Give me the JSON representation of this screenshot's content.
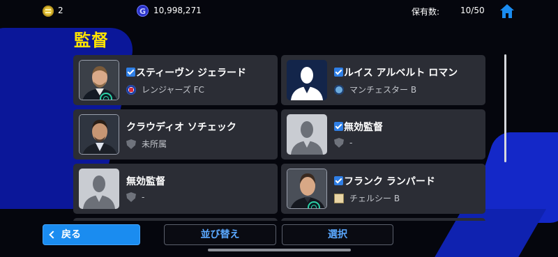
{
  "header": {
    "coins": "2",
    "gp_symbol": "G",
    "gp": "10,998,271",
    "owned_label": "保有数:",
    "owned_count": "10/50"
  },
  "page_title": "監督",
  "managers": [
    {
      "name": "スティーヴン ジェラード",
      "team": "レンジャーズ FC",
      "checked": true,
      "avatar": "photo-gerrard",
      "team_icon": "rangers-crest-icon"
    },
    {
      "name": "ルイス アルベルト ロマン",
      "team": "マンチェスター B",
      "checked": true,
      "avatar": "silhouette-dark",
      "team_icon": "manchester-crest-icon"
    },
    {
      "name": "クラウディオ ソチェック",
      "team": "未所属",
      "checked": false,
      "avatar": "photo-man",
      "team_icon": "shield-icon"
    },
    {
      "name": "無効監督",
      "team": "-",
      "checked": true,
      "avatar": "silhouette-grey",
      "team_icon": "shield-icon"
    },
    {
      "name": "無効監督",
      "team": "-",
      "checked": false,
      "avatar": "silhouette-grey",
      "team_icon": "shield-icon"
    },
    {
      "name": "フランク ランパード",
      "team": "チェルシー B",
      "checked": true,
      "avatar": "photo-lampard",
      "team_icon": "chelsea-crest-icon"
    }
  ],
  "buttons": {
    "back": "戻る",
    "sort": "並び替え",
    "select": "選択"
  },
  "colors": {
    "title": "#ffe400",
    "card": "#2b2d35",
    "accent": "#1a8cf0",
    "link": "#5aa8ff"
  }
}
